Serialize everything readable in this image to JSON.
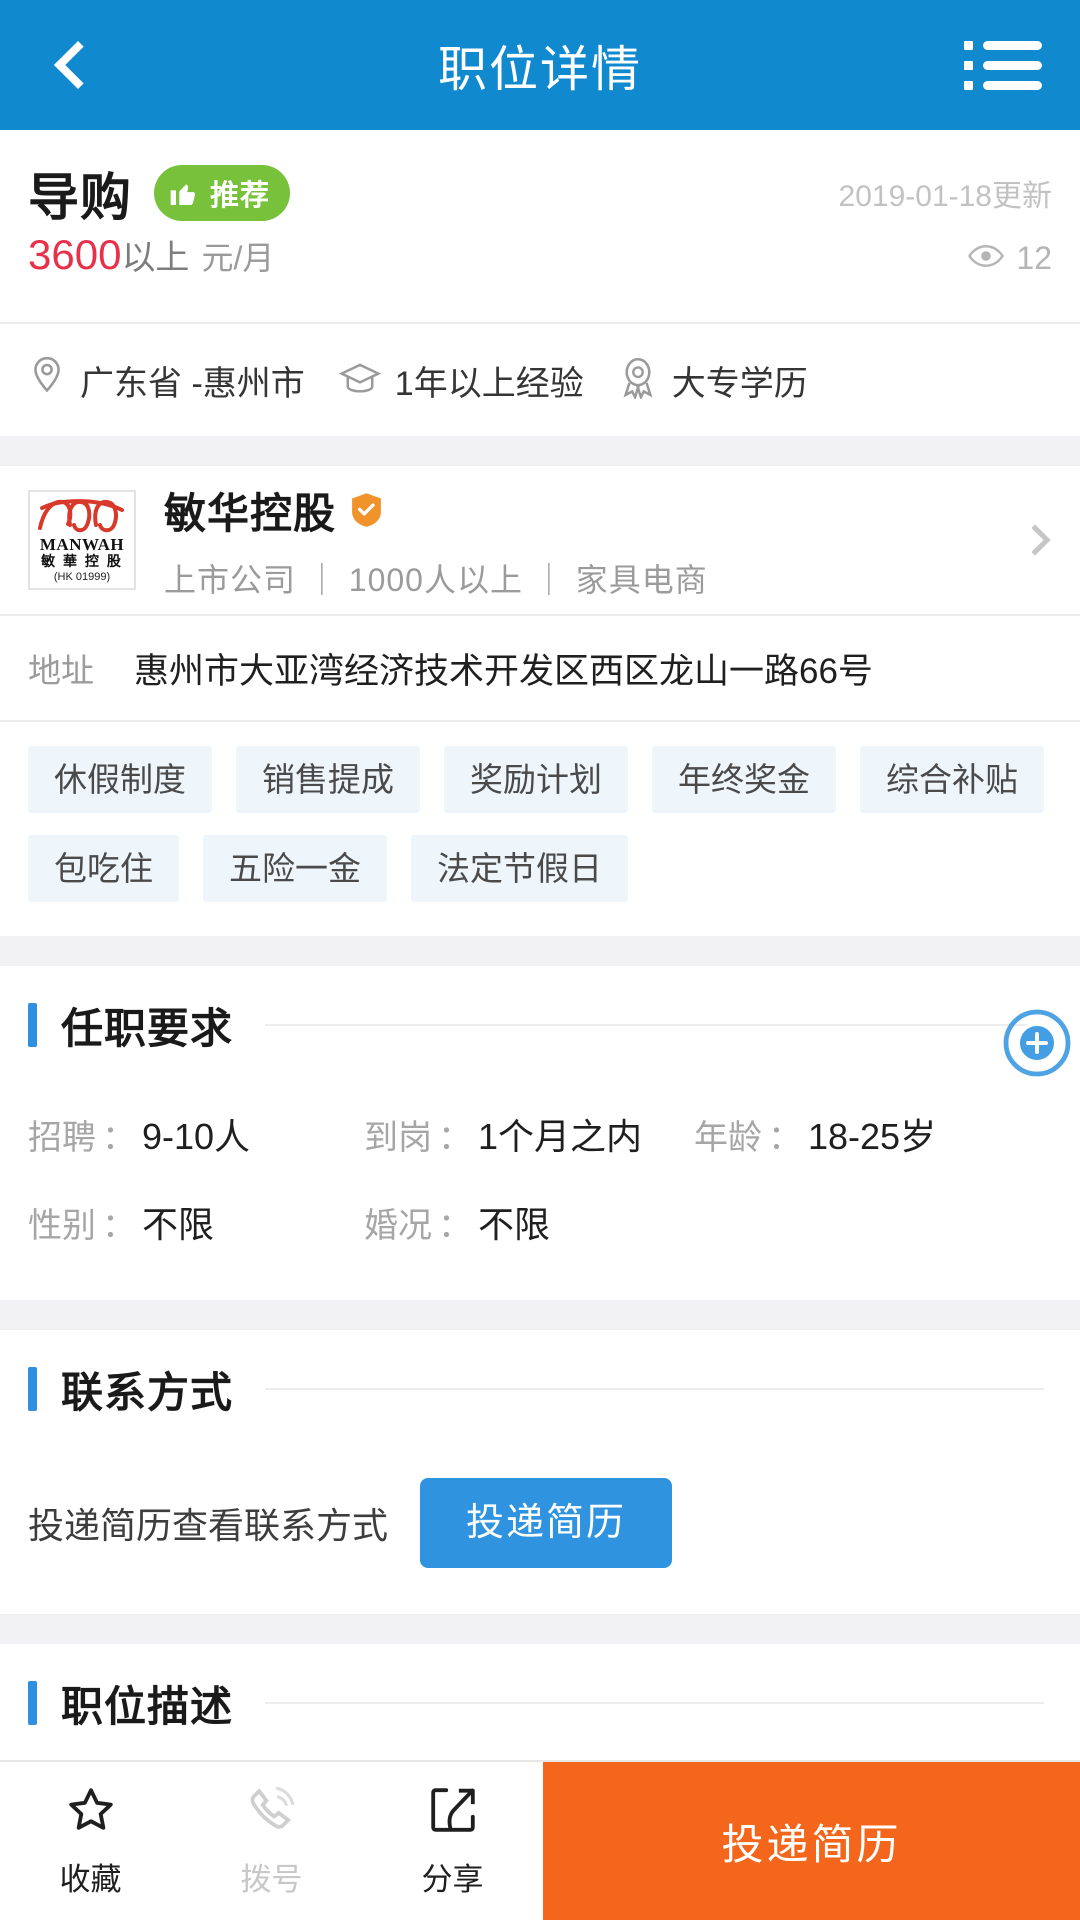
{
  "header": {
    "title": "职位详情",
    "back_icon": "chevron-left-icon",
    "menu_icon": "list-menu-icon"
  },
  "job": {
    "title": "导购",
    "recommend_badge": "推荐",
    "recommend_icon": "thumbs-up-icon",
    "updated": "2019-01-18更新",
    "salary_number": "3600",
    "salary_suffix": "以上",
    "salary_unit": "元/月",
    "views_icon": "eye-icon",
    "views_count": "12",
    "meta": [
      {
        "icon": "location-pin-icon",
        "label": "广东省 -惠州市"
      },
      {
        "icon": "graduation-cap-icon",
        "label": "1年以上经验"
      },
      {
        "icon": "medal-icon",
        "label": "大专学历"
      }
    ]
  },
  "company": {
    "name": "敏华控股",
    "verified_icon": "verified-shield-icon",
    "meta": "上市公司 ｜ 1000人以上 ｜ 家具电商",
    "arrow_icon": "chevron-right-icon",
    "logo": {
      "brand_en": "MANWAH",
      "brand_cn": "敏 華 控 股",
      "listing_code": "(HK 01999)"
    },
    "address_label": "地址",
    "address_value": "惠州市大亚湾经济技术开发区西区龙山一路66号"
  },
  "benefits": [
    "休假制度",
    "销售提成",
    "奖励计划",
    "年终奖金",
    "综合补贴",
    "包吃住",
    "五险一金",
    "法定节假日"
  ],
  "requirements": {
    "section_title": "任职要求",
    "rows": [
      [
        {
          "key": "招聘",
          "sep": "：",
          "value": "9-10人"
        },
        {
          "key": "到岗",
          "sep": "：",
          "value": "1个月之内"
        },
        {
          "key": "年龄",
          "sep": "：",
          "value": "18-25岁"
        }
      ],
      [
        {
          "key": "性别",
          "sep": "：",
          "value": "不限"
        },
        {
          "key": "婚况",
          "sep": "：",
          "value": "不限"
        }
      ]
    ]
  },
  "contact": {
    "section_title": "联系方式",
    "hint": "投递简历查看联系方式",
    "button": "投递简历"
  },
  "description": {
    "section_title": "职位描述"
  },
  "bottom_bar": {
    "items": [
      {
        "icon": "star-icon",
        "label": "收藏",
        "disabled": false
      },
      {
        "icon": "phone-icon",
        "label": "拨号",
        "disabled": true
      },
      {
        "icon": "share-icon",
        "label": "分享",
        "disabled": false
      }
    ],
    "cta": "投递简历"
  },
  "colors": {
    "header_blue": "#1089ce",
    "accent_blue": "#2f93e0",
    "cta_orange": "#f4661b",
    "salary_red": "#e8304b",
    "badge_green": "#77c23a",
    "verified_orange": "#f0932a",
    "tag_bg": "#eef6fc"
  },
  "touch_indicator": {
    "icon": "touch-target-icon"
  }
}
